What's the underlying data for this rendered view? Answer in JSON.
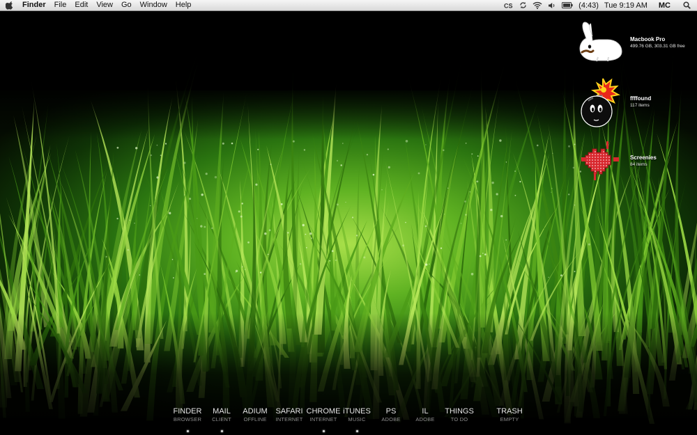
{
  "menubar": {
    "app_name": "Finder",
    "menus": [
      "File",
      "Edit",
      "View",
      "Go",
      "Window",
      "Help"
    ],
    "battery_time": "(4:43)",
    "clock": "Tue 9:19 AM",
    "user": "MC"
  },
  "desktop_icons": [
    {
      "name": "Macbook Pro",
      "info": "499.76 GB, 303.31 GB free",
      "icon": "rabbit-drive-icon"
    },
    {
      "name": "ffffound",
      "info": "117 items",
      "icon": "bomb-folder-icon"
    },
    {
      "name": "Screenies",
      "info": "84 items",
      "icon": "invader-folder-icon"
    }
  ],
  "dock": [
    {
      "label": "FINDER",
      "sub": "BROWSER",
      "running": true
    },
    {
      "label": "MAIL",
      "sub": "CLIENT",
      "running": true
    },
    {
      "label": "ADIUM",
      "sub": "OFFLINE",
      "running": false
    },
    {
      "label": "SAFARI",
      "sub": "INTERNET",
      "running": false
    },
    {
      "label": "CHROME",
      "sub": "INTERNET",
      "running": true
    },
    {
      "label": "iTUNES",
      "sub": "MUSIC",
      "running": true
    },
    {
      "label": "PS",
      "sub": "ADOBE",
      "running": false
    },
    {
      "label": "IL",
      "sub": "ADOBE",
      "running": false
    },
    {
      "label": "THINGS",
      "sub": "TO DO",
      "running": false
    },
    {
      "label": "TRASH",
      "sub": "EMPTY",
      "running": false
    }
  ],
  "colors": {
    "menubar": "#e6e6e6",
    "grass_bright": "#8fd03a",
    "grass_dark": "#1f5a0c",
    "dock_label": "#e6e6e6",
    "dock_sub": "#8f8f8f"
  }
}
